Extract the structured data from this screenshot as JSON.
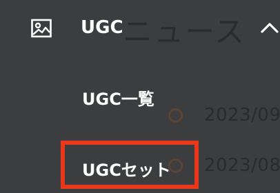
{
  "background": {
    "heading": "ニュース",
    "dates": [
      "2023/09",
      "2023/08"
    ]
  },
  "menu": {
    "section_label": "UGC",
    "section_icon": "image-icon",
    "toggle_icon": "chevron-up-icon",
    "items": [
      {
        "label": "UGC一覧"
      },
      {
        "label": "UGCセット"
      }
    ]
  },
  "colors": {
    "background": "#3c3d3e",
    "highlight": "#e8371a",
    "text": "#ffffff",
    "muted_text": "#2a2b2c",
    "circle": "#5b4434"
  }
}
